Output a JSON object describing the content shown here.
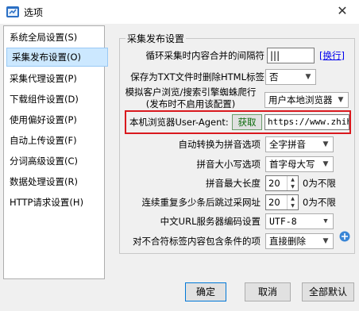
{
  "window": {
    "title": "选项"
  },
  "sidebar": {
    "items": [
      {
        "label": "系统全局设置(S)"
      },
      {
        "label": "采集发布设置(O)",
        "selected": true
      },
      {
        "label": "采集代理设置(P)"
      },
      {
        "label": "下载组件设置(D)"
      },
      {
        "label": "使用偏好设置(P)"
      },
      {
        "label": "自动上传设置(F)"
      },
      {
        "label": "分词高级设置(C)"
      },
      {
        "label": "数据处理设置(R)"
      },
      {
        "label": "HTTP请求设置(H)"
      }
    ]
  },
  "group": {
    "title": "采集发布设置",
    "loop_separator": {
      "label": "循环采集时内容合并的间隔符",
      "value": "|||",
      "link": "[换行]"
    },
    "remove_html": {
      "label": "保存为TXT文件时删除HTML标签",
      "value": "否"
    },
    "simulate_browser": {
      "label_line1": "模拟客户浏览/搜索引擎蜘蛛爬行",
      "label_line2": "(发布时不启用该配置)",
      "value": "用户本地浏览器"
    },
    "user_agent": {
      "label": "本机浏览器User-Agent:",
      "button": "获取",
      "value": "https://www.zhihu"
    },
    "pinyin": {
      "label": "自动转换为拼音选项",
      "value": "全字拼音"
    },
    "pinyin_case": {
      "label": "拼音大小写选项",
      "value": "首字母大写"
    },
    "pinyin_max": {
      "label": "拼音最大长度",
      "value": "20",
      "suffix": "0为不限"
    },
    "skip_count": {
      "label": "连续重复多少条后跳过采网址",
      "value": "20",
      "suffix": "0为不限"
    },
    "url_encoding": {
      "label": "中文URL服务器编码设置",
      "value": "UTF-8"
    },
    "tag_handling": {
      "label": "对不合符标签内容包含条件的项",
      "value": "直接删除"
    }
  },
  "buttons": {
    "ok": "确定",
    "cancel": "取消",
    "defaults": "全部默认"
  },
  "colors": {
    "highlight": "#d9191e",
    "selection": "#cce8ff",
    "link": "#0000ee"
  }
}
